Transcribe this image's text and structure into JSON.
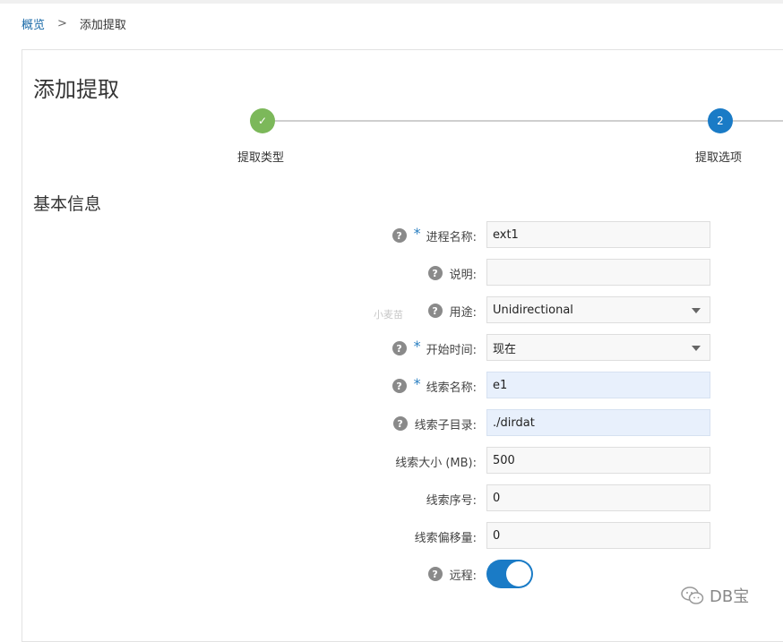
{
  "breadcrumb": {
    "home": "概览",
    "separator": ">",
    "current": "添加提取"
  },
  "page": {
    "title": "添加提取"
  },
  "steps": [
    {
      "label": "提取类型",
      "status": "done"
    },
    {
      "label": "提取选项",
      "number": "2",
      "status": "active"
    }
  ],
  "section": {
    "title": "基本信息"
  },
  "form": {
    "process_name": {
      "label": "进程名称:",
      "value": "ext1",
      "required": true,
      "help": true
    },
    "description": {
      "label": "说明:",
      "value": "",
      "help": true
    },
    "purpose": {
      "label": "用途:",
      "value": "Unidirectional",
      "help": true
    },
    "start_time": {
      "label": "开始时间:",
      "value": "现在",
      "required": true,
      "help": true
    },
    "trail_name": {
      "label": "线索名称:",
      "value": "e1",
      "required": true,
      "help": true
    },
    "trail_subdir": {
      "label": "线索子目录:",
      "value": "./dirdat",
      "help": true
    },
    "trail_size": {
      "label": "线索大小 (MB):",
      "value": "500"
    },
    "trail_seq": {
      "label": "线索序号:",
      "value": "0"
    },
    "trail_offset": {
      "label": "线索偏移量:",
      "value": "0"
    },
    "remote": {
      "label": "远程:",
      "enabled": true,
      "help": true
    }
  },
  "icons": {
    "help": "?",
    "required": "*",
    "check": "✓"
  },
  "watermarks": {
    "left": "小麦苗",
    "brand": "DB宝"
  },
  "colors": {
    "accent": "#1a7bc6",
    "done": "#7cb85a",
    "link": "#1a6aa8",
    "highlight": "#e8f0fc"
  }
}
